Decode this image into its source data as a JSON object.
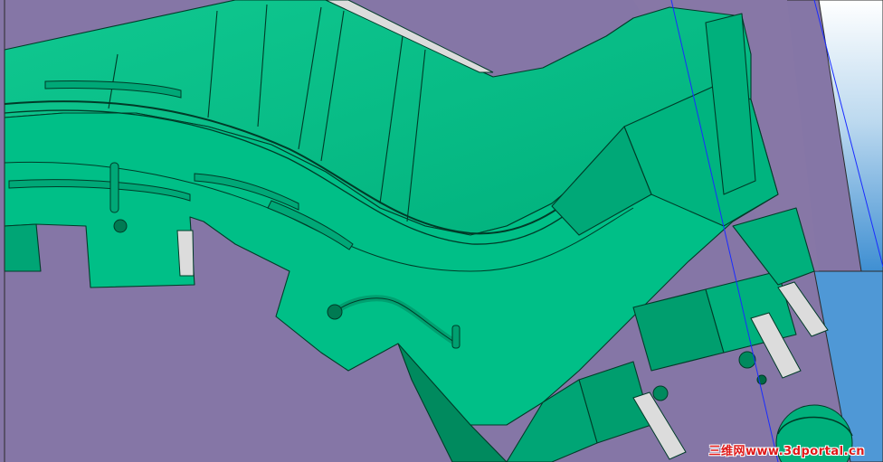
{
  "viewport": {
    "background_color": "#8576a6",
    "model_color": "#00bf87",
    "model_dark_color": "#008a5e",
    "edge_color": "#003b28",
    "highlight_color": "#dcdcdc",
    "plane_color": "#5aa0d8",
    "axis_line_color": "#1a2cff"
  },
  "watermark": {
    "text": "三维网www.3dportal.cn",
    "color": "#e01818"
  }
}
